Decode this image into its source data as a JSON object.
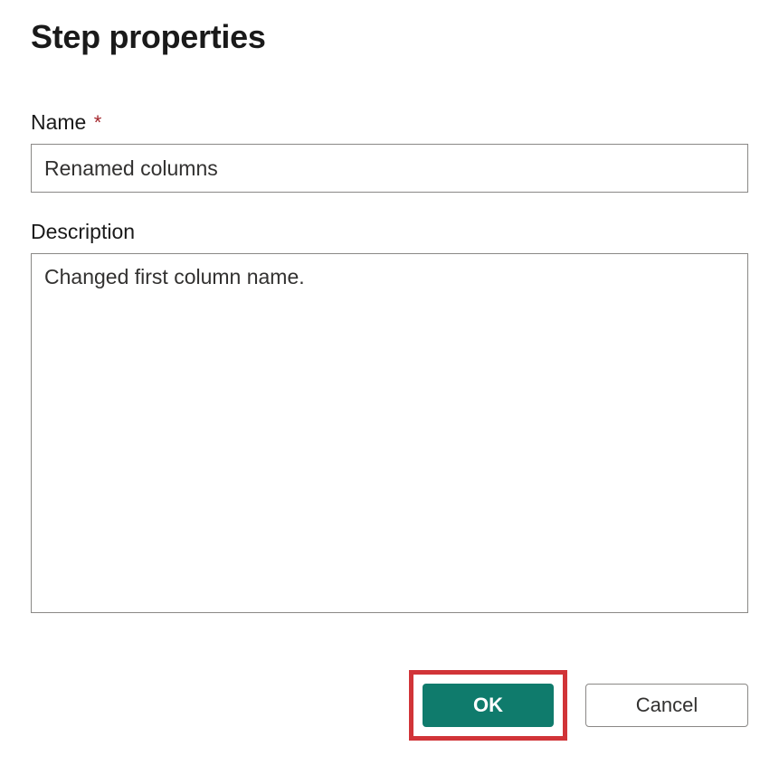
{
  "dialog": {
    "title": "Step properties"
  },
  "fields": {
    "name": {
      "label": "Name",
      "required_marker": "*",
      "value": "Renamed columns"
    },
    "description": {
      "label": "Description",
      "value": "Changed first column name."
    }
  },
  "buttons": {
    "ok": "OK",
    "cancel": "Cancel"
  }
}
